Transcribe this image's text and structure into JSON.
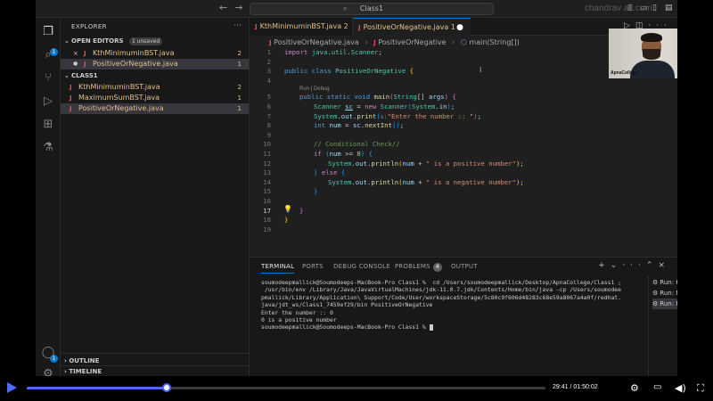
{
  "window": {
    "search_text": "Class1",
    "watermark": "chandrav              ail.com"
  },
  "sidebar": {
    "title": "EXPLORER",
    "open_editors": {
      "label": "OPEN EDITORS",
      "badge": "1 unsaved",
      "items": [
        {
          "lead": "×",
          "icon": "J",
          "name": "KthMinimuminBST.java",
          "count": "2"
        },
        {
          "lead": "●",
          "icon": "J",
          "name": "PositiveOrNegative.java",
          "count": "1"
        }
      ]
    },
    "folder": {
      "label": "CLASS1",
      "items": [
        {
          "icon": "J",
          "name": "KthMinimuminBST.java",
          "count": "2"
        },
        {
          "icon": "J",
          "name": "MaximumSumBST.java",
          "count": "1"
        },
        {
          "icon": "J",
          "name": "PositiveOrNegative.java",
          "count": "1"
        }
      ]
    },
    "outline": "OUTLINE",
    "timeline": "TIMELINE",
    "badges": {
      "explorer": "1",
      "accounts": "1"
    }
  },
  "editor": {
    "tabs": [
      {
        "icon": "J",
        "label": "KthMinimuminBST.java 2"
      },
      {
        "icon": "J",
        "label": "PositiveOrNegative.java 1",
        "modified": "●"
      }
    ],
    "breadcrumb": {
      "file": "PositiveOrNegative.java",
      "cls": "PositiveOrNegative",
      "method": "main(String[])"
    },
    "codelens": "Run | Debug",
    "line_numbers": [
      "1",
      "2",
      "3",
      "4",
      "5",
      "6",
      "7",
      "8",
      "9",
      "10",
      "11",
      "12",
      "13",
      "14",
      "15",
      "16",
      "17",
      "18",
      "19"
    ],
    "current_line": "17"
  },
  "webcam": {
    "logo": "ApnaCollege"
  },
  "panel": {
    "tabs": [
      "TERMINAL",
      "PORTS",
      "DEBUG CONSOLE",
      "PROBLEMS",
      "OUTPUT"
    ],
    "problems_count": "4",
    "terminal_lines": [
      "soumodeepmallick@Soumodeeps-MacBook-Pro Class1 %  cd /Users/soumodeepmallick/Desktop/ApnaCollege/Class1 ;",
      " /usr/bin/env /Library/Java/JavaVirtualMachines/jdk-11.0.7.jdk/Contents/Home/bin/java -cp /Users/soumodee",
      "pmallick/Library/Application\\ Support/Code/User/workspaceStorage/5c80c9f606d48283c68e59a8067a4a0f/redhat.",
      "java/jdt_ws/Class1_7459ef29/bin PositiveOrNegative",
      "Enter the number :: 0",
      "0 is a positive number",
      "soumodeepmallick@Soumodeeps-MacBook-Pro Class1 % "
    ],
    "terminals": [
      "Run: KthMi...",
      "Run: Maxi...",
      "Run: Positi..."
    ]
  },
  "player": {
    "time": "29:41 / 01:50:02",
    "progress": 0.27
  }
}
